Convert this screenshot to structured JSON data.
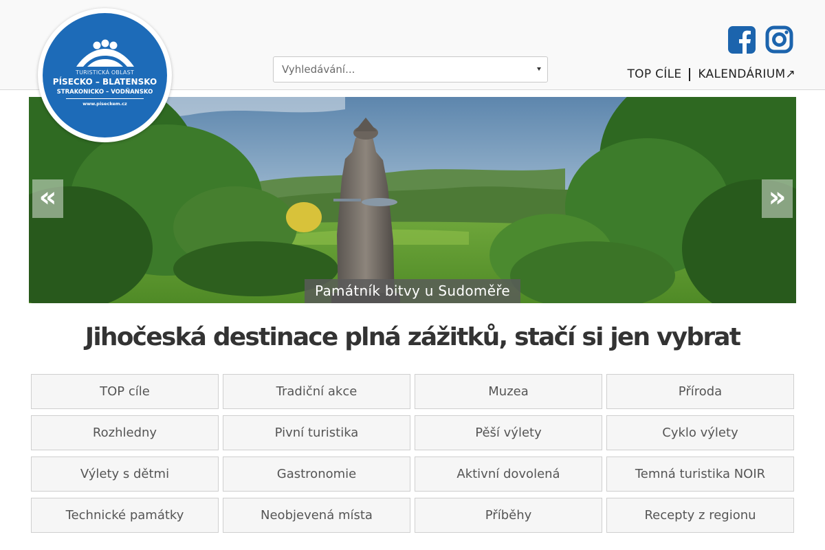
{
  "logo": {
    "line1": "TURISTICKÁ OBLAST",
    "line2": "PÍSECKO – BLATENSKO",
    "line3": "STRAKONICKO – VODŇANSKO",
    "url": "www.piseckem.cz",
    "color": "#1d6bb8"
  },
  "search": {
    "placeholder": "Vyhledávání..."
  },
  "social": {
    "facebook_icon": "facebook-icon",
    "instagram_icon": "instagram-icon",
    "color": "#1c64ad"
  },
  "nav": {
    "top_cile": "TOP CÍLE",
    "kalendarium": "KALENDÁRIUM↗"
  },
  "hero": {
    "caption": "Památník bitvy u Sudoměře",
    "prev": "«",
    "next": "»"
  },
  "headline": "Jihočeská destinace plná zážitků, stačí si jen vybrat",
  "tiles": [
    "TOP cíle",
    "Tradiční akce",
    "Muzea",
    "Příroda",
    "Rozhledny",
    "Pivní turistika",
    "Pěší výlety",
    "Cyklo výlety",
    "Výlety s dětmi",
    "Gastronomie",
    "Aktivní dovolená",
    "Temná turistika NOIR",
    "Technické památky",
    "Neobjevená místa",
    "Příběhy",
    "Recepty z regionu"
  ]
}
